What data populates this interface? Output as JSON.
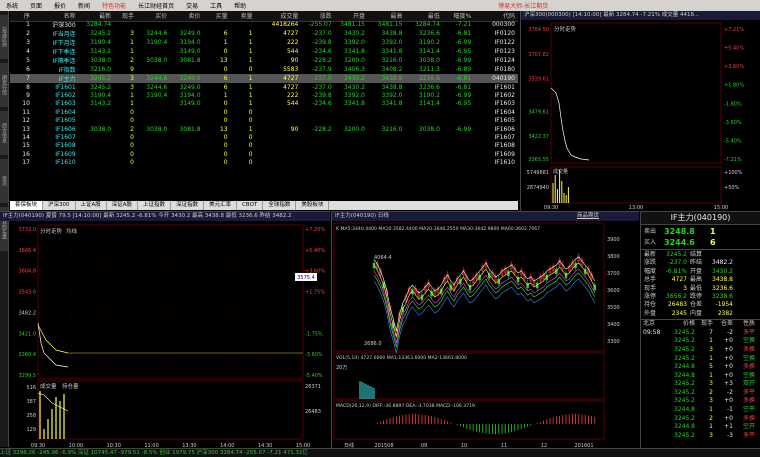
{
  "menu": {
    "items": [
      "系统",
      "页面",
      "报价",
      "新闻",
      "特色功能",
      "长江财经首页",
      "交易",
      "工具",
      "帮助"
    ],
    "title": "博易大师-长江期货"
  },
  "sidebar": {
    "items": [
      "自选区块",
      "期货行情",
      "综合信息",
      "资讯",
      "我的实盘"
    ]
  },
  "quote_table": {
    "headers": [
      "序",
      "名称",
      "最新",
      "现手",
      "买价",
      "卖价",
      "买量",
      "卖量",
      "成交量",
      "涨跌",
      "开盘",
      "最高",
      "最低",
      "幅度%",
      "代码"
    ],
    "rows": [
      [
        "1",
        "沪深300",
        "3284.74",
        "",
        "",
        "",
        "",
        "",
        "4418264",
        "-255.07",
        "3481.15",
        "3481.15",
        "3284.74",
        "-7.21",
        "000300"
      ],
      [
        "2",
        "IF当月连",
        "3245.2",
        "3",
        "3244.6",
        "3249.0",
        "6",
        "1",
        "4727",
        "-237.0",
        "3430.2",
        "3438.8",
        "3236.6",
        "-6.81",
        "IF0120"
      ],
      [
        "3",
        "IF下月连",
        "3190.4",
        "1",
        "3190.4",
        "3194.0",
        "1",
        "1",
        "222",
        "-239.8",
        "3392.0",
        "3392.0",
        "3190.2",
        "-6.99",
        "IF0122"
      ],
      [
        "4",
        "IF下季连",
        "3143.2",
        "1",
        "",
        "3149.0",
        "0",
        "1",
        "544",
        "-234.6",
        "3341.8",
        "3341.8",
        "3141.4",
        "-6.95",
        "IF0123"
      ],
      [
        "5",
        "IF隔季连",
        "3038.0",
        "2",
        "3038.0",
        "3081.8",
        "13",
        "1",
        "90",
        "-228.2",
        "3200.0",
        "3216.0",
        "3038.0",
        "-6.99",
        "IF0124"
      ],
      [
        "6",
        "IF指数",
        "3216.0",
        "9",
        "",
        "",
        "0",
        "0",
        "5583",
        "-237.9",
        "3406.3",
        "3408.2",
        "3211.3",
        "-6.89",
        "IF0180"
      ],
      [
        "7",
        "IF主力",
        "3245.2",
        "3",
        "3244.6",
        "3249.0",
        "6",
        "1",
        "4727",
        "-237.0",
        "3430.2",
        "3438.8",
        "3236.6",
        "-6.81",
        "040190"
      ],
      [
        "8",
        "IF1601",
        "3245.2",
        "3",
        "3244.6",
        "3249.0",
        "6",
        "1",
        "4727",
        "-237.0",
        "3430.2",
        "3438.8",
        "3236.6",
        "-6.81",
        "IF1601"
      ],
      [
        "9",
        "IF1602",
        "3190.4",
        "1",
        "3190.4",
        "3194.0",
        "1",
        "1",
        "222",
        "-239.8",
        "3392.0",
        "3392.0",
        "3190.2",
        "-6.99",
        "IF1602"
      ],
      [
        "10",
        "IF1603",
        "3143.2",
        "1",
        "",
        "3149.0",
        "0",
        "1",
        "544",
        "-234.6",
        "3341.8",
        "3341.8",
        "3141.4",
        "-6.95",
        "IF1603"
      ],
      [
        "11",
        "IF1604",
        "",
        "0",
        "",
        "",
        "0",
        "0",
        "",
        "",
        "",
        "",
        "",
        "",
        "IF1604"
      ],
      [
        "12",
        "IF1605",
        "",
        "0",
        "",
        "",
        "0",
        "0",
        "",
        "",
        "",
        "",
        "",
        "",
        "IF1605"
      ],
      [
        "13",
        "IF1606",
        "3038.0",
        "2",
        "3038.0",
        "3081.8",
        "13",
        "1",
        "90",
        "-228.2",
        "3200.0",
        "3216.0",
        "3038.0",
        "-6.99",
        "IF1606"
      ],
      [
        "14",
        "IF1607",
        "",
        "0",
        "",
        "",
        "0",
        "0",
        "",
        "",
        "",
        "",
        "",
        "",
        "IF1607"
      ],
      [
        "15",
        "IF1608",
        "",
        "0",
        "",
        "",
        "0",
        "0",
        "",
        "",
        "",
        "",
        "",
        "",
        "IF1608"
      ],
      [
        "16",
        "IF1609",
        "",
        "0",
        "",
        "",
        "0",
        "0",
        "",
        "",
        "",
        "",
        "",
        "",
        "IF1609"
      ],
      [
        "17",
        "IF1610",
        "",
        "0",
        "",
        "",
        "0",
        "0",
        "",
        "",
        "",
        "",
        "",
        "",
        "IF1610"
      ]
    ]
  },
  "tabs": [
    "套保板块",
    "沪深300",
    "上证A股",
    "深证A股",
    "上证指数",
    "深证指数",
    "美元汇率",
    "CBOT",
    "全球指数",
    "美股板块"
  ],
  "right_top": {
    "header": "沪深300(000300)  [14:10:00]  最新 3284.74 -7.21%  成交量 4418...",
    "label": "分时走势",
    "vol_label": "成交量",
    "left_ticks": [
      "3764.50",
      "3707.82",
      "3539.61",
      "3479.61",
      "3422.37",
      "3365.55"
    ],
    "right_ticks": [
      "+7.21%",
      "+5.40%",
      "+3.60%",
      "+1.80%",
      "-1.80%",
      "-3.60%",
      "-5.40%",
      "-7.21%"
    ],
    "vol_ticks": [
      "5749881",
      "2874940"
    ],
    "vol_pct": [
      "+100%",
      "+50%"
    ],
    "time_ticks": [
      "09:30",
      "13:00",
      "15:00"
    ]
  },
  "bottom_left": {
    "header": "IF主力(040190) 夏普   79.5  [14:10:00]  最新 3245.2 -6.81%  今开 3430.2  最高 3438.8  最低 3236.6  昨结 3482.2",
    "label": "分时走势",
    "label2": "均线",
    "left_ticks": [
      "3732.0",
      "3666.4",
      "3604.8",
      "3543.6",
      "3482.2",
      "3421.0",
      "3360.4",
      "3299.5"
    ],
    "right_ticks": [
      "+7.20%",
      "+5.40%",
      "+3.60%",
      "+1.75%",
      "",
      "-1.75%",
      "-3.60%",
      "-5.40%"
    ],
    "price_flag": "3575.4",
    "vol_label": "成交量",
    "oi_label": "持仓量",
    "vol_ticks": [
      "516",
      "387",
      "258",
      "129"
    ],
    "oi_ticks": [
      "28371",
      "26483"
    ],
    "time_ticks": [
      "09:30",
      "10:00",
      "10:30",
      "11:00",
      "13:30",
      "14:00",
      "14:30",
      "15:00"
    ]
  },
  "bottom_mid": {
    "header": "IF主力(040190) 日线",
    "top_right_label": "商品期货",
    "ma_legend": "K  MA5:3440.4400  MA10:3582.4400  MA20:3646.2550  MA30:3642.9800  MA60:3602.7067",
    "price_ticks": [
      "3900",
      "3800",
      "3700",
      "3600",
      "3500",
      "3400",
      "3300"
    ],
    "high_label": "4064.4",
    "low_label": "2686.0",
    "vol_legend": "VOL(5,10)  4727.0000  MA1:13363.6000  MA2:13661.8000",
    "vol_tick": "20万",
    "macd_legend": "MACD(26,12,9)  DIFF:-36.8897  DEA:-3.7038  MACD:-106.3719",
    "date_ticks": [
      "日线",
      "201508",
      "09",
      "10",
      "11",
      "12",
      "201601"
    ]
  },
  "order_book": {
    "title": "IF主力(040190)",
    "sell_label": "卖出",
    "sell_price": "3248.8",
    "sell_vol": "1",
    "buy_label": "买入",
    "buy_price": "3244.6",
    "buy_vol": "6",
    "stats": [
      [
        "最新",
        "3245.2",
        "结算",
        ""
      ],
      [
        "涨跌",
        "-237.0",
        "昨结",
        "3482.2"
      ],
      [
        "幅度",
        "-6.81%",
        "开盘",
        "3430.2"
      ],
      [
        "总手",
        "4727",
        "最高",
        "3438.8"
      ],
      [
        "现手",
        "3",
        "最低",
        "3236.6"
      ],
      [
        "涨停",
        "3656.2",
        "跌停",
        "3238.6"
      ],
      [
        "持仓",
        "26483",
        "仓差",
        "-1954"
      ],
      [
        "外盘",
        "2345",
        "内盘",
        "2382"
      ]
    ],
    "trade_headers": [
      "北京",
      "价格",
      "现手",
      "仓差",
      "性质"
    ],
    "trades": [
      [
        "09:58",
        "3245.2",
        "7",
        "-2",
        "多平"
      ],
      [
        "",
        "3245.2",
        "1",
        "+0",
        "空换"
      ],
      [
        "",
        "3245.2",
        "3",
        "+0",
        "多换"
      ],
      [
        "",
        "3245.2",
        "1",
        "+0",
        "空换"
      ],
      [
        "",
        "3244.8",
        "5",
        "+0",
        "多换"
      ],
      [
        "",
        "3244.8",
        "1",
        "+0",
        "空换"
      ],
      [
        "",
        "3245.2",
        "3",
        "+3",
        "双开"
      ],
      [
        "",
        "3245.2",
        "2",
        "-2",
        "多平"
      ],
      [
        "",
        "3245.2",
        "3",
        "+0",
        "多换"
      ],
      [
        "",
        "3244.8",
        "1",
        "-1",
        "空平"
      ],
      [
        "",
        "3245.2",
        "2",
        "+0",
        "多换"
      ],
      [
        "",
        "3244.8",
        "1",
        "+1",
        "空开"
      ],
      [
        "",
        "3245.2",
        "3",
        "-3",
        "多平"
      ]
    ]
  },
  "status_bar": {
    "text": "上证 3296.26  -245.96  -6.9%  深证 10745.47  -979.51  -8.5%  创业 1979.75  沪深300 3284.74  -255.07  -7.21  471.31亿"
  },
  "colors": {
    "up": "#ff3c3c",
    "down": "#28d028",
    "price_line": "#ffffff",
    "avg_line": "#ffff3c",
    "highlight": "#555555"
  }
}
